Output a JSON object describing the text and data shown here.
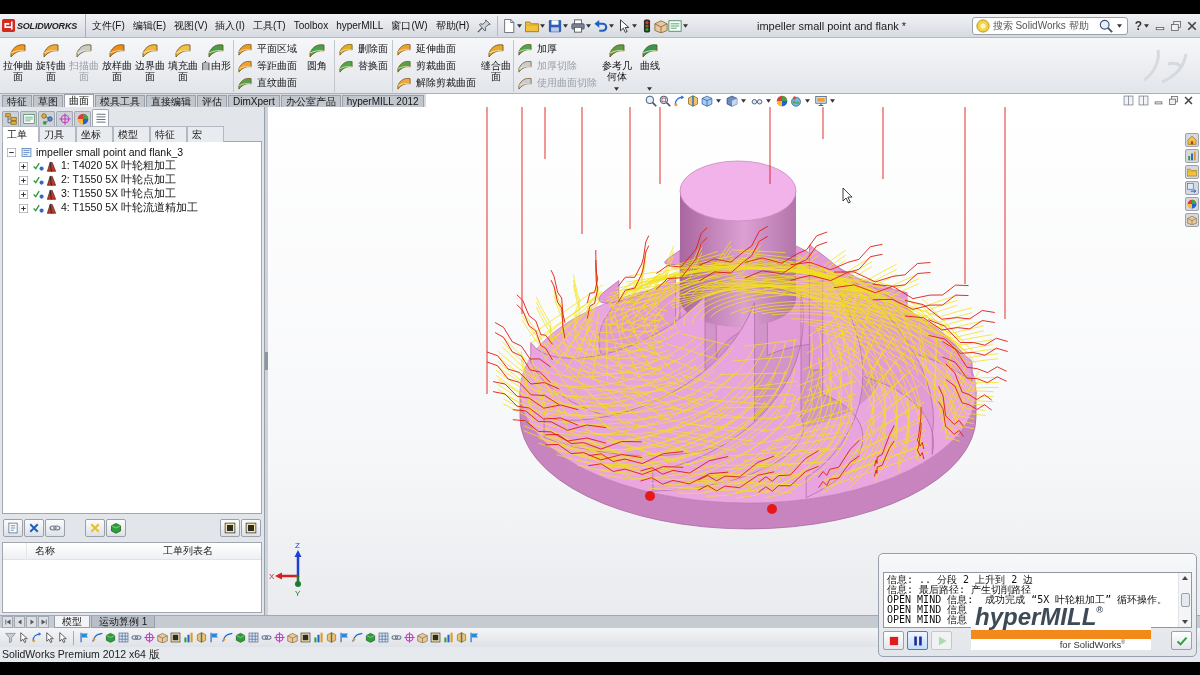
{
  "app_bar": {
    "logo": "SOLIDWORKS",
    "menus": [
      "文件(F)",
      "编辑(E)",
      "视图(V)",
      "插入(I)",
      "工具(T)",
      "Toolbox",
      "hyperMILL",
      "窗口(W)",
      "帮助(H)"
    ],
    "document_title": "impeller small point and flank *",
    "search": {
      "placeholder": "搜索 SolidWorks 帮助"
    },
    "help": "?"
  },
  "ribbon": [
    {
      "kind": "large",
      "label": "拉伸曲面",
      "disabled": false,
      "dropdown": false
    },
    {
      "kind": "large",
      "label": "旋转曲面",
      "disabled": false,
      "dropdown": false
    },
    {
      "kind": "large",
      "label": "扫描曲面",
      "disabled": true,
      "dropdown": false
    },
    {
      "kind": "large",
      "label": "放样曲面",
      "disabled": false,
      "dropdown": false
    },
    {
      "kind": "large",
      "label": "边界曲面",
      "disabled": false,
      "dropdown": false
    },
    {
      "kind": "large",
      "label": "填充曲面",
      "disabled": false,
      "dropdown": false
    },
    {
      "kind": "large",
      "label": "自由形",
      "disabled": false,
      "dropdown": false
    },
    {
      "kind": "stack",
      "items": [
        {
          "label": "平面区域",
          "disabled": false
        },
        {
          "label": "等距曲面",
          "disabled": false
        },
        {
          "label": "直纹曲面",
          "disabled": false
        }
      ]
    },
    {
      "kind": "large",
      "label": "圆角",
      "disabled": false,
      "dropdown": false
    },
    {
      "kind": "stack",
      "items": [
        {
          "label": "删除面",
          "disabled": false
        },
        {
          "label": "替换面",
          "disabled": false
        }
      ]
    },
    {
      "kind": "stack",
      "items": [
        {
          "label": "延伸曲面",
          "disabled": false
        },
        {
          "label": "剪裁曲面",
          "disabled": false
        },
        {
          "label": "解除剪裁曲面",
          "disabled": false
        }
      ]
    },
    {
      "kind": "large",
      "label": "缝合曲面",
      "disabled": false,
      "dropdown": false
    },
    {
      "kind": "stack",
      "items": [
        {
          "label": "加厚",
          "disabled": false
        },
        {
          "label": "加厚切除",
          "disabled": true
        },
        {
          "label": "使用曲面切除",
          "disabled": true
        }
      ]
    },
    {
      "kind": "large",
      "label": "参考几何体",
      "disabled": false,
      "dropdown": true
    },
    {
      "kind": "large",
      "label": "曲线",
      "disabled": false,
      "dropdown": true
    }
  ],
  "command_tabs": [
    {
      "label": "特征",
      "selected": false
    },
    {
      "label": "草图",
      "selected": false
    },
    {
      "label": "曲面",
      "selected": true
    },
    {
      "label": "模具工具",
      "selected": false
    },
    {
      "label": "直接编辑",
      "selected": false
    },
    {
      "label": "评估",
      "selected": false
    },
    {
      "label": "DimXpert",
      "selected": false
    },
    {
      "label": "办公室产品",
      "selected": false
    },
    {
      "label": "hyperMILL 2012",
      "selected": false
    }
  ],
  "left_panel": {
    "icon_tabs": [
      {
        "selected": false
      },
      {
        "selected": false
      },
      {
        "selected": false
      },
      {
        "selected": false
      },
      {
        "selected": false
      },
      {
        "selected": true
      }
    ],
    "tabs": [
      {
        "label": "工单",
        "selected": true
      },
      {
        "label": "刀具",
        "selected": false
      },
      {
        "label": "坐标",
        "selected": false
      },
      {
        "label": "模型",
        "selected": false
      },
      {
        "label": "特征",
        "selected": false
      },
      {
        "label": "宏",
        "selected": false
      }
    ],
    "tree": {
      "label": "impeller small point and flank_3",
      "expanded": true,
      "children": [
        {
          "label": "1: T4020 5X 叶轮粗加工",
          "expanded": false
        },
        {
          "label": "2: T1550 5X 叶轮点加工",
          "expanded": false
        },
        {
          "label": "3: T1550 5X 叶轮点加工",
          "expanded": false
        },
        {
          "label": "4: T1550 5X 叶轮流道精加工",
          "expanded": false
        }
      ]
    },
    "list": {
      "columns": [
        "名称",
        "工单列表名"
      ]
    }
  },
  "triad": {
    "z": "Z",
    "x": "X",
    "y": "Y"
  },
  "message_dialog": {
    "lines": [
      [
        "信息: .. 分段 2 上升到 2 边"
      ],
      [
        "信息: 最后路径: 产生切削路径"
      ],
      [
        "OPEN MIND 信息:",
        "成功完成 “5X 叶轮粗加工” 循环操作。"
      ],
      [
        "OPEN MIND 信息"
      ],
      [
        "OPEN MIND 信息"
      ]
    ],
    "splash": {
      "title": "hyperMILL$^{®}$",
      "subtitle": "for SolidWorks$^{®}$"
    },
    "buttons": [
      {
        "kind": "stop",
        "selected": false,
        "disabled": false
      },
      {
        "kind": "pause",
        "selected": true,
        "disabled": false
      },
      {
        "kind": "play",
        "selected": false,
        "disabled": true
      },
      {
        "kind": "ok",
        "selected": false,
        "disabled": false
      }
    ]
  },
  "bottom_tabs": [
    {
      "label": "模型",
      "selected": true
    },
    {
      "label": "运动算例 1",
      "selected": false
    }
  ],
  "status_bar": "SolidWorks Premium 2012 x64 版"
}
